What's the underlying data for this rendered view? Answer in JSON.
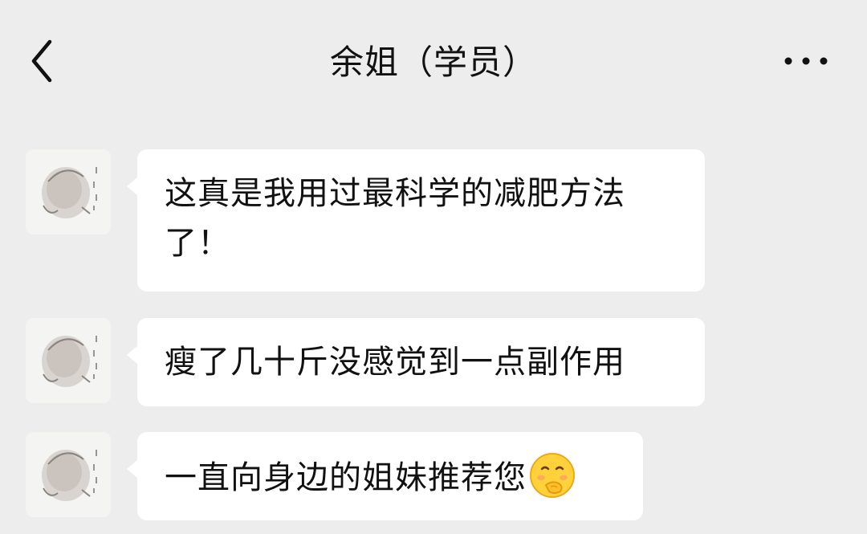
{
  "header": {
    "title": "余姐（学员）",
    "back_icon": "chevron-left-icon",
    "more_icon": "more-dots-icon"
  },
  "messages": [
    {
      "text": "这真是我用过最科学的减肥方法了！"
    },
    {
      "text": "瘦了几十斤没感觉到一点副作用"
    },
    {
      "text": "一直向身边的姐妹推荐您",
      "emoji": "shy-blushing-emoji"
    }
  ],
  "colors": {
    "background": "#ededed",
    "bubble": "#ffffff",
    "text": "#111111"
  }
}
